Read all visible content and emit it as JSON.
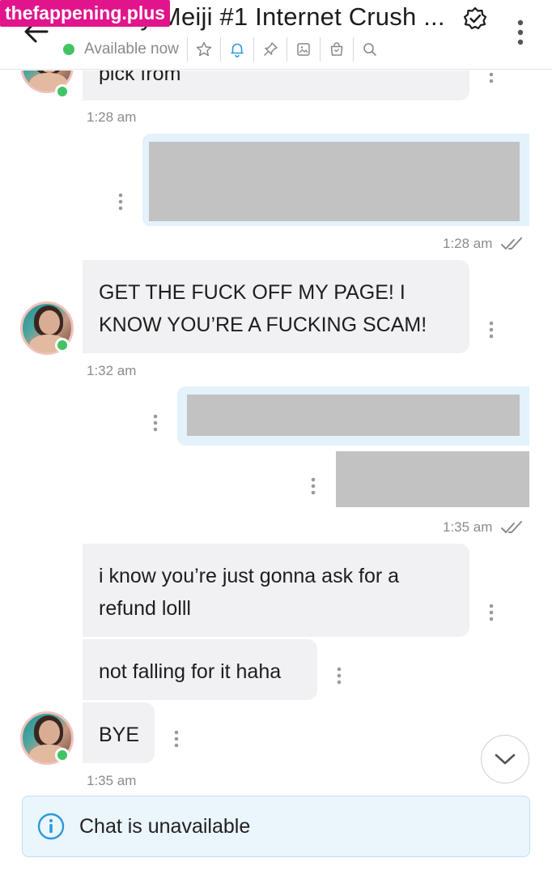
{
  "header": {
    "title": "Foxcey Meiji #1 Internet Crush ...",
    "status": "Available now",
    "watermark": "thefappening.plus"
  },
  "messages": {
    "m0_text": "pick from",
    "m0_time": "1:28 am",
    "m1_time": "1:28 am",
    "m2_text": "GET THE FUCK OFF MY PAGE! I KNOW YOU’RE A FUCKING SCAM!",
    "m2_time": "1:32 am",
    "m3_time": "1:35 am",
    "m4_text": "i know you’re just gonna ask for a refund lolll",
    "m5_text": "not falling for it haha",
    "m6_text": "BYE",
    "m6_time": "1:35 am"
  },
  "footer": {
    "unavailable": "Chat is unavailable"
  },
  "colors": {
    "online": "#43c464",
    "incoming_bubble": "#f1f1f3",
    "outgoing_bubble": "#e3f2fb",
    "accent_blue": "#2b9ad9"
  }
}
